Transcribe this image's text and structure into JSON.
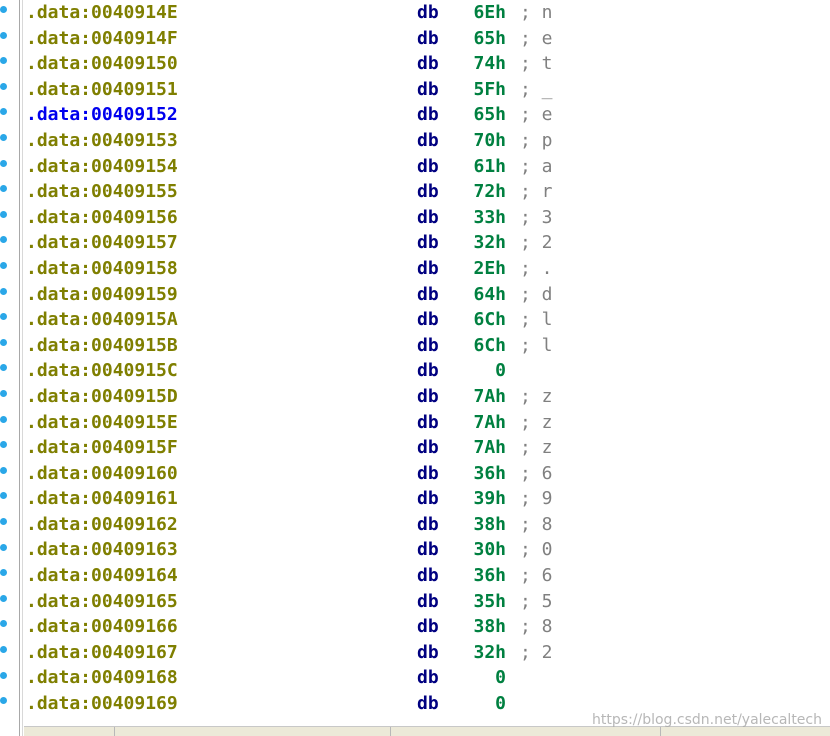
{
  "listing": {
    "rows": [
      {
        "address": ".data:0040914E",
        "mnemonic": "db",
        "value": "6Eh",
        "comment": "; n"
      },
      {
        "address": ".data:0040914F",
        "mnemonic": "db",
        "value": "65h",
        "comment": "; e"
      },
      {
        "address": ".data:00409150",
        "mnemonic": "db",
        "value": "74h",
        "comment": "; t"
      },
      {
        "address": ".data:00409151",
        "mnemonic": "db",
        "value": "5Fh",
        "comment": "; _"
      },
      {
        "address": ".data:00409152",
        "mnemonic": "db",
        "value": "65h",
        "comment": "; e"
      },
      {
        "address": ".data:00409153",
        "mnemonic": "db",
        "value": "70h",
        "comment": "; p"
      },
      {
        "address": ".data:00409154",
        "mnemonic": "db",
        "value": "61h",
        "comment": "; a"
      },
      {
        "address": ".data:00409155",
        "mnemonic": "db",
        "value": "72h",
        "comment": "; r"
      },
      {
        "address": ".data:00409156",
        "mnemonic": "db",
        "value": "33h",
        "comment": "; 3"
      },
      {
        "address": ".data:00409157",
        "mnemonic": "db",
        "value": "32h",
        "comment": "; 2"
      },
      {
        "address": ".data:00409158",
        "mnemonic": "db",
        "value": "2Eh",
        "comment": "; ."
      },
      {
        "address": ".data:00409159",
        "mnemonic": "db",
        "value": "64h",
        "comment": "; d"
      },
      {
        "address": ".data:0040915A",
        "mnemonic": "db",
        "value": "6Ch",
        "comment": "; l"
      },
      {
        "address": ".data:0040915B",
        "mnemonic": "db",
        "value": "6Ch",
        "comment": "; l"
      },
      {
        "address": ".data:0040915C",
        "mnemonic": "db",
        "value": "0",
        "comment": ""
      },
      {
        "address": ".data:0040915D",
        "mnemonic": "db",
        "value": "7Ah",
        "comment": "; z"
      },
      {
        "address": ".data:0040915E",
        "mnemonic": "db",
        "value": "7Ah",
        "comment": "; z"
      },
      {
        "address": ".data:0040915F",
        "mnemonic": "db",
        "value": "7Ah",
        "comment": "; z"
      },
      {
        "address": ".data:00409160",
        "mnemonic": "db",
        "value": "36h",
        "comment": "; 6"
      },
      {
        "address": ".data:00409161",
        "mnemonic": "db",
        "value": "39h",
        "comment": "; 9"
      },
      {
        "address": ".data:00409162",
        "mnemonic": "db",
        "value": "38h",
        "comment": "; 8"
      },
      {
        "address": ".data:00409163",
        "mnemonic": "db",
        "value": "30h",
        "comment": "; 0"
      },
      {
        "address": ".data:00409164",
        "mnemonic": "db",
        "value": "36h",
        "comment": "; 6"
      },
      {
        "address": ".data:00409165",
        "mnemonic": "db",
        "value": "35h",
        "comment": "; 5"
      },
      {
        "address": ".data:00409166",
        "mnemonic": "db",
        "value": "38h",
        "comment": "; 8"
      },
      {
        "address": ".data:00409167",
        "mnemonic": "db",
        "value": "32h",
        "comment": "; 2"
      },
      {
        "address": ".data:00409168",
        "mnemonic": "db",
        "value": "0",
        "comment": ""
      },
      {
        "address": ".data:00409169",
        "mnemonic": "db",
        "value": "0",
        "comment": ""
      }
    ]
  },
  "colors": {
    "address": "#7f7f00",
    "address_current": "#0000ee",
    "mnemonic": "#000080",
    "value": "#008040",
    "comment": "#808080",
    "gutter_dot": "#2aa7e8"
  },
  "icons": {
    "gutter_marker": "breakpoint-dot-icon"
  },
  "watermark": {
    "text": "https://blog.csdn.net/yalecaltech"
  }
}
